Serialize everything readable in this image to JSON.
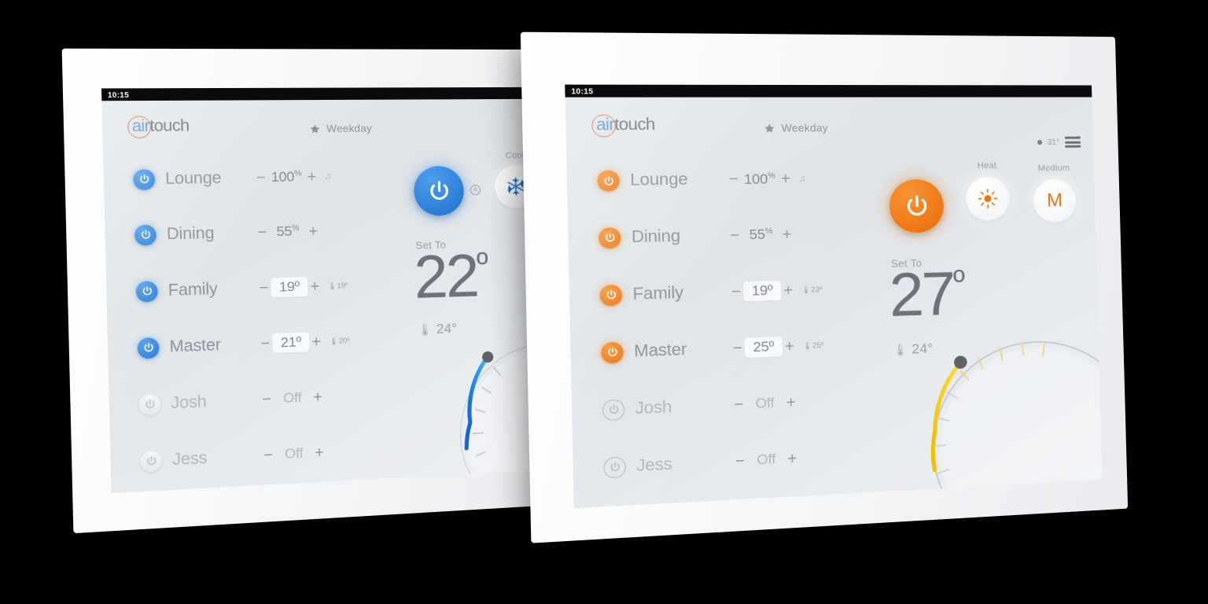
{
  "scene": {
    "background_color": "#000000",
    "device_count": 2
  },
  "panels": [
    {
      "id": "left-panel-cool",
      "accent_color": "#2f86e0",
      "status_bar": {
        "time": "10:15"
      },
      "logo": {
        "ring": "airtouch-ring",
        "part1": "air",
        "part2": "touch"
      },
      "schedule": {
        "icon": "star-icon",
        "label": "Weekday"
      },
      "zones": [
        {
          "name": "Lounge",
          "state": "on",
          "value": "100",
          "unit": "%",
          "boxed": false,
          "sensor": "",
          "note": "spill-icon"
        },
        {
          "name": "Dining",
          "state": "on",
          "value": "55",
          "unit": "%",
          "boxed": false,
          "sensor": "",
          "note": ""
        },
        {
          "name": "Family",
          "state": "on",
          "value": "19º",
          "unit": "",
          "boxed": true,
          "sensor": "19º",
          "note": ""
        },
        {
          "name": "Master",
          "state": "on",
          "value": "21º",
          "unit": "",
          "boxed": true,
          "sensor": "20º",
          "note": ""
        },
        {
          "name": "Josh",
          "state": "off",
          "value": "Off",
          "unit": "",
          "boxed": false,
          "sensor": "",
          "note": ""
        },
        {
          "name": "Jess",
          "state": "off",
          "value": "Off",
          "unit": "",
          "boxed": false,
          "sensor": "",
          "note": ""
        }
      ],
      "controls": {
        "power": {
          "state": "on",
          "icon": "power-icon"
        },
        "auto_badge": "A",
        "mode": {
          "label": "Cool",
          "icon": "snowflake-icon",
          "color": "#2f86e0"
        },
        "fan": null
      },
      "display": {
        "set_to_label": "Set To",
        "set_temp": "22",
        "degree": "º",
        "current_temp": "24°",
        "thermometer_icon": "thermometer-icon"
      },
      "dial": {
        "arc_color_start": "#3fb3ea",
        "arc_color_end": "#1565d8",
        "handle_color": "#5e6268"
      },
      "topright": null
    },
    {
      "id": "right-panel-heat",
      "accent_color": "#ee7412",
      "status_bar": {
        "time": "10:15"
      },
      "logo": {
        "ring": "airtouch-ring",
        "part1": "air",
        "part2": "touch"
      },
      "schedule": {
        "icon": "star-icon",
        "label": "Weekday"
      },
      "zones": [
        {
          "name": "Lounge",
          "state": "on",
          "value": "100",
          "unit": "%",
          "boxed": false,
          "sensor": "",
          "note": "spill-icon"
        },
        {
          "name": "Dining",
          "state": "on",
          "value": "55",
          "unit": "%",
          "boxed": false,
          "sensor": "",
          "note": ""
        },
        {
          "name": "Family",
          "state": "on",
          "value": "19º",
          "unit": "",
          "boxed": true,
          "sensor": "23º",
          "note": ""
        },
        {
          "name": "Master",
          "state": "on",
          "value": "25º",
          "unit": "",
          "boxed": true,
          "sensor": "25º",
          "note": ""
        },
        {
          "name": "Josh",
          "state": "off",
          "value": "Off",
          "unit": "",
          "boxed": false,
          "sensor": "",
          "note": ""
        },
        {
          "name": "Jess",
          "state": "off",
          "value": "Off",
          "unit": "",
          "boxed": false,
          "sensor": "",
          "note": ""
        }
      ],
      "controls": {
        "power": {
          "state": "on",
          "icon": "power-icon"
        },
        "auto_badge": null,
        "mode": {
          "label": "Heat",
          "icon": "sun-icon",
          "color": "#ee7412"
        },
        "fan": {
          "label": "Medium",
          "letter": "M"
        }
      },
      "display": {
        "set_to_label": "Set To",
        "set_temp": "27",
        "degree": "º",
        "current_temp": "24°",
        "thermometer_icon": "thermometer-icon"
      },
      "dial": {
        "arc_color_start": "#f2c200",
        "arc_color_end": "#f3d21a",
        "handle_color": "#5e6268"
      },
      "topright": {
        "weather_icon": "weather-dot-icon",
        "outdoor_temp": "31°",
        "menu_icon": "hamburger-menu-icon"
      }
    }
  ]
}
